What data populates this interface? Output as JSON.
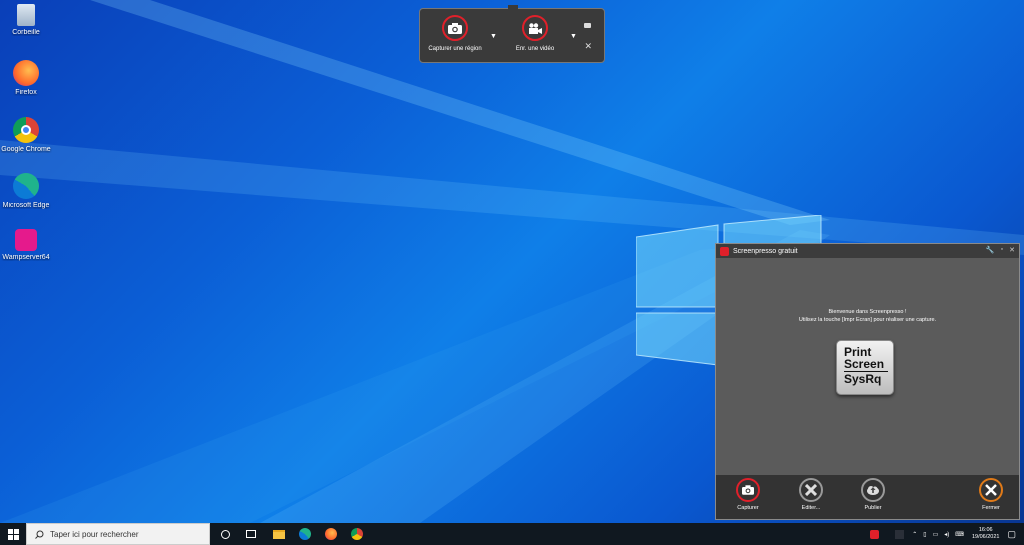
{
  "desktop": {
    "icons": [
      {
        "label": "Corbeille",
        "icon": "recycle-bin-icon"
      },
      {
        "label": "Firefox",
        "icon": "firefox-icon"
      },
      {
        "label": "Google Chrome",
        "icon": "chrome-icon"
      },
      {
        "label": "Microsoft Edge",
        "icon": "edge-icon"
      },
      {
        "label": "Wampserver64",
        "icon": "wampserver-icon"
      }
    ]
  },
  "capture_bar": {
    "region_label": "Capturer une région",
    "video_label": "Enr. une vidéo",
    "icons": [
      "camera-icon",
      "video-camera-icon",
      "toolbox-icon",
      "close-icon"
    ]
  },
  "screenpresso": {
    "title": "Screenpresso gratuit",
    "welcome_line1": "Bienvenue dans Screenpresso !",
    "welcome_line2": "Utilisez la touche [Impr Ecran] pour réaliser une capture.",
    "key": {
      "line1": "Print",
      "line2": "Screen",
      "line3": "SysRq"
    },
    "buttons": {
      "capture": "Capturer",
      "edit": "Editer...",
      "publish": "Publier",
      "close": "Fermer"
    },
    "colors": {
      "accent": "#e0202a",
      "close_ring": "#e07a18"
    }
  },
  "taskbar": {
    "search_placeholder": "Taper ici pour rechercher",
    "time": "16:06",
    "date": "19/06/2021"
  }
}
